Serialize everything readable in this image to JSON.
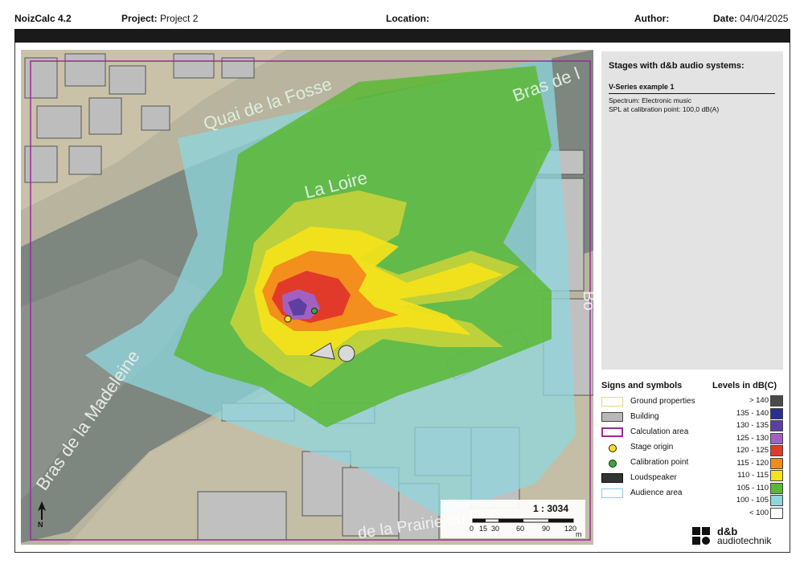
{
  "header": {
    "app_name": "NoizCalc 4.2",
    "project_label": "Project:",
    "project_value": "Project 2",
    "location_label": "Location:",
    "location_value": "",
    "author_label": "Author:",
    "author_value": "",
    "date_label": "Date:",
    "date_value": "04/04/2025"
  },
  "map": {
    "labels": {
      "quai": "Quai de la Fosse",
      "loire": "La Loire",
      "bras_madeleine": "Bras de la Madeleine",
      "bras_top": "Bras de l",
      "prairie": "de la Prairie au Duc",
      "side_bo": "Bo"
    },
    "scale": {
      "ratio": "1 : 3034",
      "ticks": [
        "0",
        "15",
        "30",
        "60",
        "90",
        "120"
      ],
      "unit": "m"
    },
    "north_label": "N"
  },
  "stages_panel": {
    "title": "Stages with d&b audio systems:",
    "example_name": "V-Series example 1",
    "spectrum": "Spectrum:  Electronic music",
    "spl": "SPL at calibration point:  100,0 dB(A)"
  },
  "signs": {
    "title": "Signs and symbols",
    "items": [
      {
        "label": "Ground properties",
        "icon": "ground-properties-symbol"
      },
      {
        "label": "Building",
        "icon": "building-symbol"
      },
      {
        "label": "Calculation area",
        "icon": "calculation-area-symbol"
      },
      {
        "label": "Stage origin",
        "icon": "stage-origin-dot"
      },
      {
        "label": "Calibration point",
        "icon": "calibration-point-dot"
      },
      {
        "label": "Loudspeaker",
        "icon": "loudspeaker-symbol"
      },
      {
        "label": "Audience area",
        "icon": "audience-area-symbol"
      }
    ]
  },
  "levels": {
    "title": "Levels in dB(C)",
    "items": [
      {
        "label": "> 140",
        "color": "#4a4a4a"
      },
      {
        "label": "135 - 140",
        "color": "#2b2f8f"
      },
      {
        "label": "130 - 135",
        "color": "#5d3fa0"
      },
      {
        "label": "125 - 130",
        "color": "#a261c0"
      },
      {
        "label": "120 - 125",
        "color": "#e23a2a"
      },
      {
        "label": "115 - 120",
        "color": "#f28a1c"
      },
      {
        "label": "110 - 115",
        "color": "#f5e21a"
      },
      {
        "label": "105 - 110",
        "color": "#5bb834"
      },
      {
        "label": "100 - 105",
        "color": "#8fd7de"
      },
      {
        "label": "< 100",
        "color": "#ffffff"
      }
    ]
  },
  "logo": {
    "line1": "d&b",
    "line2": "audiotechnik"
  },
  "colors": {
    "calc_area": "#9a2a9a",
    "water": "#858c86",
    "ground": "#b9b39a"
  }
}
